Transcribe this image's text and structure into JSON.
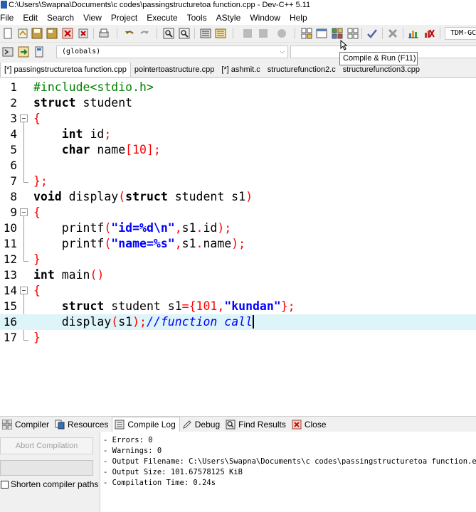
{
  "window": {
    "title": "C:\\Users\\Swapna\\Documents\\c codes\\passingstructuretoa function.cpp - Dev-C++ 5.11"
  },
  "menu": [
    "File",
    "Edit",
    "Search",
    "View",
    "Project",
    "Execute",
    "Tools",
    "AStyle",
    "Window",
    "Help"
  ],
  "toolbar": {
    "compiler_select": "TDM-GCC",
    "scope_select": "(globals)",
    "tooltip": "Compile & Run (F11)"
  },
  "tabs": [
    {
      "label": "[*] passingstructuretoa function.cpp",
      "active": true
    },
    {
      "label": "pointertoastructure.cpp",
      "active": false
    },
    {
      "label": "[*] ashmit.c",
      "active": false
    },
    {
      "label": "structurefunction2.c",
      "active": false
    },
    {
      "label": "structurefunction3.cpp",
      "active": false
    }
  ],
  "editor": {
    "line_numbers": [
      "1",
      "2",
      "3",
      "4",
      "5",
      "6",
      "7",
      "8",
      "9",
      "10",
      "11",
      "12",
      "13",
      "14",
      "15",
      "16",
      "17"
    ],
    "lines": {
      "l1_pp": "#include<stdio.h>",
      "l2_kw": "struct",
      "l2_rest": " student",
      "l3_brace": "{",
      "l4_kw": "int",
      "l4_rest": " id",
      "l4_semi": ";",
      "l5_kw": "char",
      "l5_rest": " name",
      "l5_ob": "[",
      "l5_num": "10",
      "l5_cb": "];",
      "l7_brace": "};",
      "l8_kw": "void",
      "l8_rest": " display",
      "l8_op": "(",
      "l8_kw2": "struct",
      "l8_rest2": " student s1",
      "l8_cp": ")",
      "l9_brace": "{",
      "l10_fn": "printf",
      "l10_op": "(",
      "l10_str": "\"id=%d\\n\"",
      "l10_rest": ",s1",
      "l10_dot": ".",
      "l10_rest2": "id",
      "l10_end": ");",
      "l11_fn": "printf",
      "l11_op": "(",
      "l11_str": "\"name=%s\"",
      "l11_rest": ",s1",
      "l11_dot": ".",
      "l11_rest2": "name",
      "l11_end": ");",
      "l12_brace": "}",
      "l13_kw": "int",
      "l13_rest": " main",
      "l13_paren": "()",
      "l14_brace": "{",
      "l15_kw": "struct",
      "l15_rest": " student s1",
      "l15_op": "={",
      "l15_num": "101",
      "l15_comma": ",",
      "l15_str": "\"kundan\"",
      "l15_end": "};",
      "l16_fn": "display",
      "l16_op": "(",
      "l16_arg": "s1",
      "l16_end": ");",
      "l16_comment": "//function call",
      "l17_brace": "}"
    }
  },
  "bottom_tabs": [
    "Compiler",
    "Resources",
    "Compile Log",
    "Debug",
    "Find Results",
    "Close"
  ],
  "bottom_panel": {
    "abort_button": "Abort Compilation",
    "shorten_paths_label": "Shorten compiler paths",
    "log_lines": [
      "- Errors: 0",
      "- Warnings: 0",
      "- Output Filename: C:\\Users\\Swapna\\Documents\\c codes\\passingstructuretoa function.exe",
      "- Output Size: 101.67578125 KiB",
      "- Compilation Time: 0.24s"
    ]
  },
  "colors": {
    "keyword": "#000000",
    "string": "#0000ff",
    "number": "#ff0000",
    "symbol": "#ff0000",
    "preprocessor": "#008000",
    "comment": "#0000ff",
    "current_line": "#ddf4f8"
  }
}
